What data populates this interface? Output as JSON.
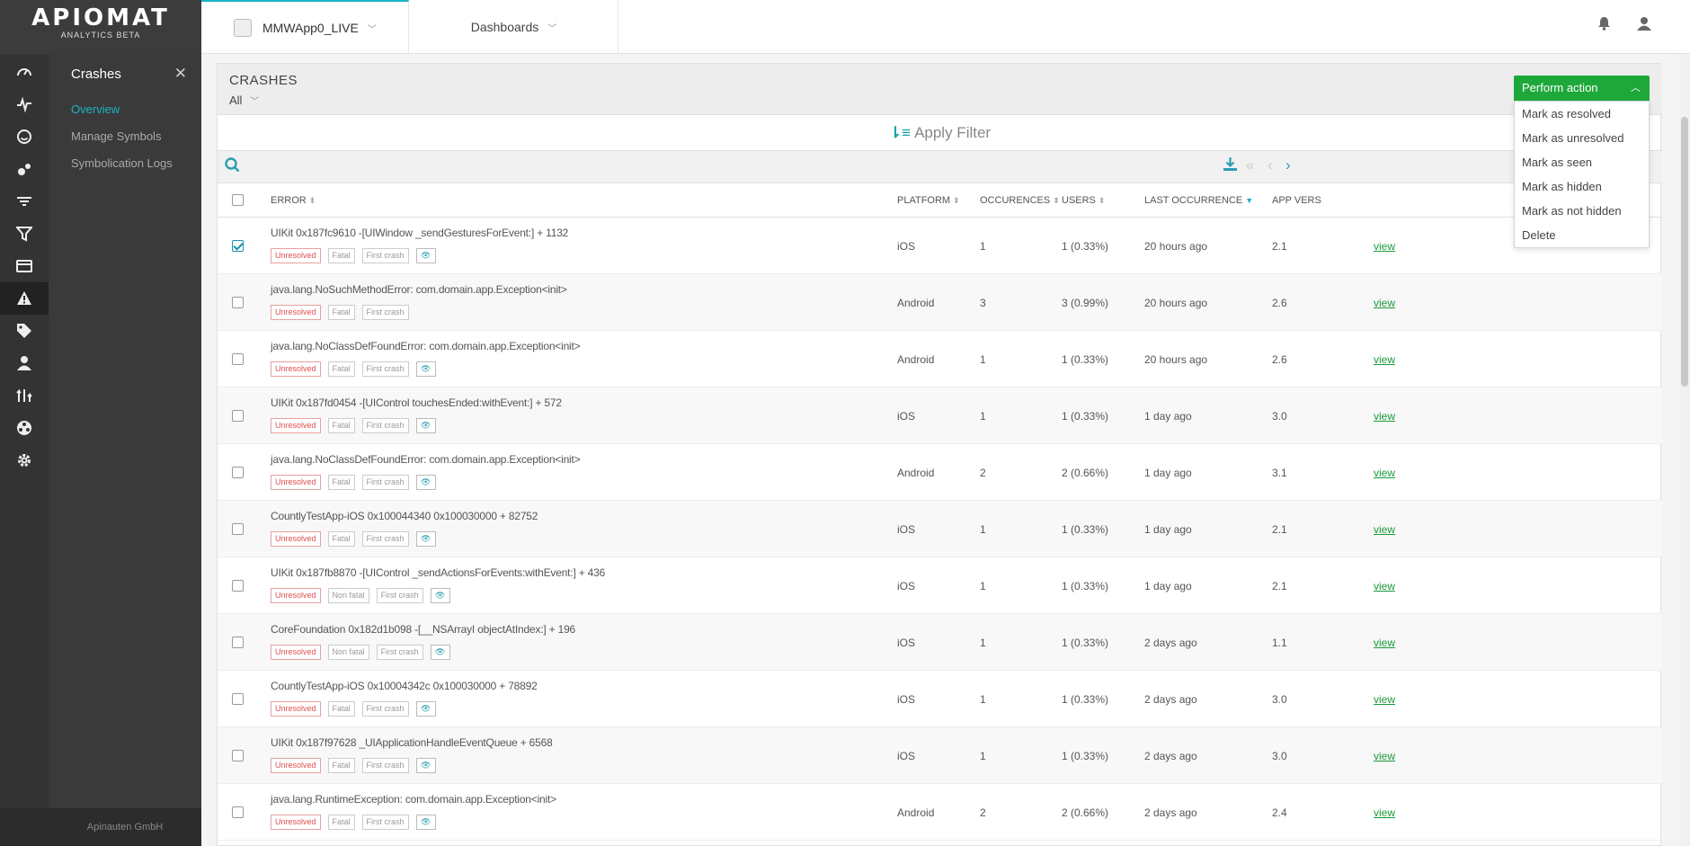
{
  "brand": {
    "logo": "APIOMAT",
    "subtitle": "ANALYTICS BETA"
  },
  "submenu": {
    "title": "Crashes",
    "items": [
      {
        "label": "Overview",
        "active": true
      },
      {
        "label": "Manage Symbols",
        "active": false
      },
      {
        "label": "Symbolication Logs",
        "active": false
      }
    ],
    "footer": "Apinauten GmbH"
  },
  "topbar": {
    "app_name": "MMWApp0_LIVE",
    "dashboards_label": "Dashboards"
  },
  "card": {
    "title": "CRASHES",
    "filter": "All",
    "apply_filter": "Apply Filter"
  },
  "action_dropdown": {
    "label": "Perform action",
    "items": [
      "Mark as resolved",
      "Mark as unresolved",
      "Mark as seen",
      "Mark as hidden",
      "Mark as not hidden",
      "Delete"
    ]
  },
  "columns": {
    "error": "ERROR",
    "platform": "PLATFORM",
    "occurrences": "OCCURENCES",
    "users": "USERS",
    "last_occurrence": "LAST OCCURRENCE",
    "app_version": "APP VERS"
  },
  "view_label": "view",
  "crashes": [
    {
      "title": "UIKit 0x187fc9610 -[UIWindow _sendGesturesForEvent:] + 1132",
      "status": "Unresolved",
      "severity": "Fatal",
      "first": "First crash",
      "eye": true,
      "platform": "iOS",
      "occ": "1",
      "users": "1 (0.33%)",
      "last": "20 hours ago",
      "ver": "2.1",
      "checked": true
    },
    {
      "title": "java.lang.NoSuchMethodError: com.domain.app.Exception<init>",
      "status": "Unresolved",
      "severity": "Fatal",
      "first": "First crash",
      "eye": false,
      "platform": "Android",
      "occ": "3",
      "users": "3 (0.99%)",
      "last": "20 hours ago",
      "ver": "2.6",
      "checked": false
    },
    {
      "title": "java.lang.NoClassDefFoundError: com.domain.app.Exception<init>",
      "status": "Unresolved",
      "severity": "Fatal",
      "first": "First crash",
      "eye": true,
      "platform": "Android",
      "occ": "1",
      "users": "1 (0.33%)",
      "last": "20 hours ago",
      "ver": "2.6",
      "checked": false
    },
    {
      "title": "UIKit 0x187fd0454 -[UIControl touchesEnded:withEvent:] + 572",
      "status": "Unresolved",
      "severity": "Fatal",
      "first": "First crash",
      "eye": true,
      "platform": "iOS",
      "occ": "1",
      "users": "1 (0.33%)",
      "last": "1 day ago",
      "ver": "3.0",
      "checked": false
    },
    {
      "title": "java.lang.NoClassDefFoundError: com.domain.app.Exception<init>",
      "status": "Unresolved",
      "severity": "Fatal",
      "first": "First crash",
      "eye": true,
      "platform": "Android",
      "occ": "2",
      "users": "2 (0.66%)",
      "last": "1 day ago",
      "ver": "3.1",
      "checked": false
    },
    {
      "title": "CountlyTestApp-iOS 0x100044340 0x100030000 + 82752",
      "status": "Unresolved",
      "severity": "Fatal",
      "first": "First crash",
      "eye": true,
      "platform": "iOS",
      "occ": "1",
      "users": "1 (0.33%)",
      "last": "1 day ago",
      "ver": "2.1",
      "checked": false
    },
    {
      "title": "UIKit 0x187fb8870 -[UIControl _sendActionsForEvents:withEvent:] + 436",
      "status": "Unresolved",
      "severity": "Non fatal",
      "first": "First crash",
      "eye": true,
      "platform": "iOS",
      "occ": "1",
      "users": "1 (0.33%)",
      "last": "1 day ago",
      "ver": "2.1",
      "checked": false
    },
    {
      "title": "CoreFoundation 0x182d1b098 -[__NSArrayI objectAtIndex:] + 196",
      "status": "Unresolved",
      "severity": "Non fatal",
      "first": "First crash",
      "eye": true,
      "platform": "iOS",
      "occ": "1",
      "users": "1 (0.33%)",
      "last": "2 days ago",
      "ver": "1.1",
      "checked": false
    },
    {
      "title": "CountlyTestApp-iOS 0x10004342c 0x100030000 + 78892",
      "status": "Unresolved",
      "severity": "Fatal",
      "first": "First crash",
      "eye": true,
      "platform": "iOS",
      "occ": "1",
      "users": "1 (0.33%)",
      "last": "2 days ago",
      "ver": "3.0",
      "checked": false
    },
    {
      "title": "UIKit 0x187f97628 _UIApplicationHandleEventQueue + 6568",
      "status": "Unresolved",
      "severity": "Fatal",
      "first": "First crash",
      "eye": true,
      "platform": "iOS",
      "occ": "1",
      "users": "1 (0.33%)",
      "last": "2 days ago",
      "ver": "3.0",
      "checked": false
    },
    {
      "title": "java.lang.RuntimeException: com.domain.app.Exception<init>",
      "status": "Unresolved",
      "severity": "Fatal",
      "first": "First crash",
      "eye": true,
      "platform": "Android",
      "occ": "2",
      "users": "2 (0.66%)",
      "last": "2 days ago",
      "ver": "2.4",
      "checked": false
    }
  ]
}
